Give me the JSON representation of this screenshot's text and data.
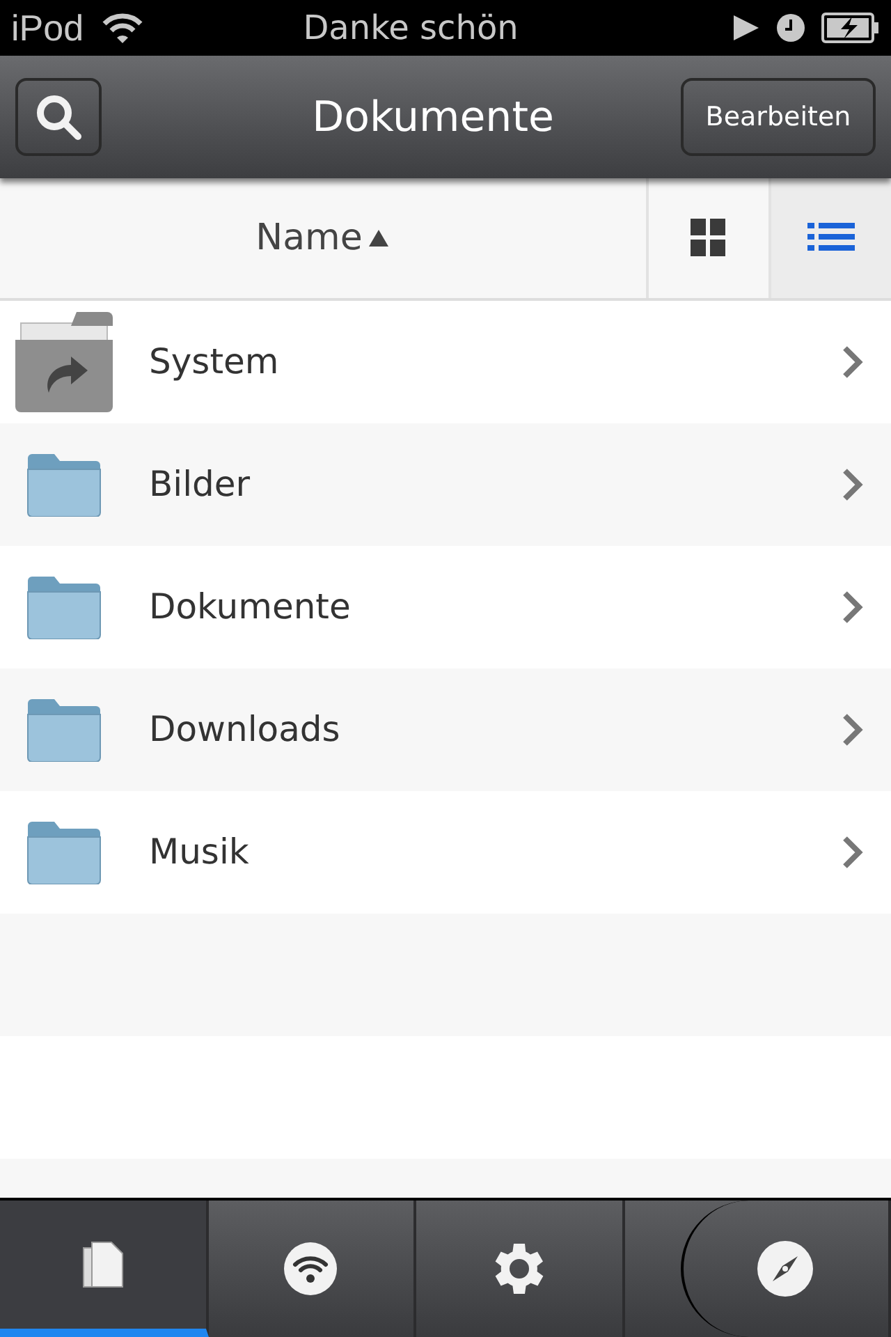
{
  "status_bar": {
    "device": "iPod",
    "title": "Danke schön"
  },
  "nav_bar": {
    "title": "Dokumente",
    "edit_button": "Bearbeiten"
  },
  "sort_header": {
    "label": "Name"
  },
  "view_toggle": [
    {
      "kind": "grid",
      "selected": false
    },
    {
      "kind": "list",
      "selected": true
    }
  ],
  "items": [
    {
      "name": "System",
      "kind": "system"
    },
    {
      "name": "Bilder",
      "kind": "folder"
    },
    {
      "name": "Dokumente",
      "kind": "folder"
    },
    {
      "name": "Downloads",
      "kind": "folder"
    },
    {
      "name": "Musik",
      "kind": "folder"
    }
  ],
  "tab_bar": [
    {
      "kind": "documents",
      "selected": true
    },
    {
      "kind": "wifi",
      "selected": false
    },
    {
      "kind": "settings",
      "selected": false
    },
    {
      "kind": "browser",
      "selected": false
    }
  ]
}
